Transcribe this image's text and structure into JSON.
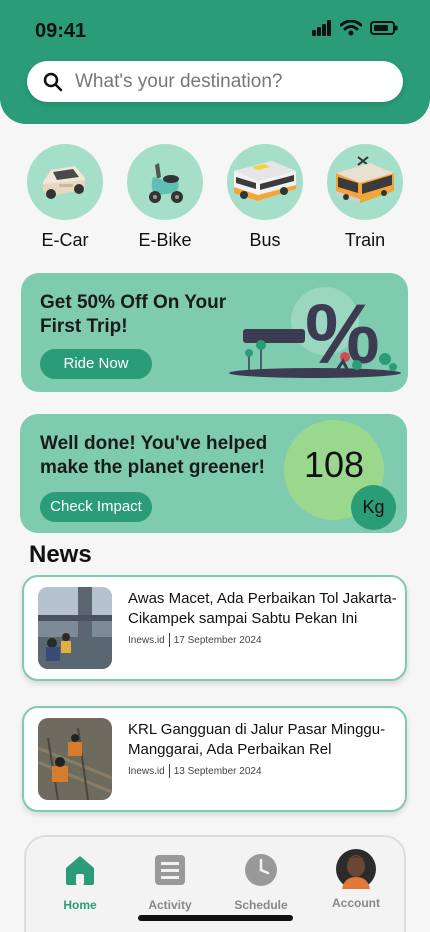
{
  "status": {
    "time": "09:41"
  },
  "search": {
    "placeholder": "What's your destination?"
  },
  "modes": [
    {
      "label": "E-Car",
      "icon": "car-icon"
    },
    {
      "label": "E-Bike",
      "icon": "scooter-icon"
    },
    {
      "label": "Bus",
      "icon": "bus-icon"
    },
    {
      "label": "Train",
      "icon": "train-icon"
    }
  ],
  "promo": {
    "title": "Get 50% Off On Your First Trip!",
    "button": "Ride Now"
  },
  "impact": {
    "title": "Well done! You've helped make the planet greener!",
    "button": "Check Impact",
    "value": "108",
    "unit": "Kg"
  },
  "news": {
    "title": "News",
    "items": [
      {
        "headline": "Awas Macet, Ada Perbaikan Tol Jakarta-Cikampek sampai Sabtu Pekan Ini",
        "source": "Inews.id",
        "date": "17 September 2024"
      },
      {
        "headline": "KRL Gangguan di Jalur Pasar Minggu-Manggarai, Ada Perbaikan Rel",
        "source": "Inews.id",
        "date": "13 September 2024"
      }
    ]
  },
  "tabs": [
    {
      "label": "Home",
      "icon": "home-icon",
      "active": true
    },
    {
      "label": "Activity",
      "icon": "list-icon",
      "active": false
    },
    {
      "label": "Schedule",
      "icon": "clock-icon",
      "active": false
    },
    {
      "label": "Account",
      "icon": "avatar",
      "active": false
    }
  ],
  "colors": {
    "primary": "#2a9d78",
    "card": "#7ecbb0",
    "mode_circle": "#a6dfc9",
    "impact_circle": "#9ad88e"
  }
}
